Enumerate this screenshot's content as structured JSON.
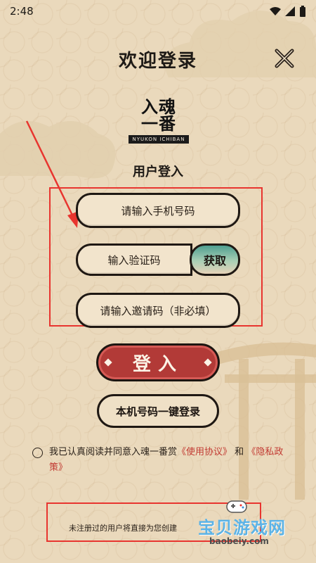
{
  "status": {
    "time": "2:48"
  },
  "header": {
    "title": "欢迎登录"
  },
  "logo": {
    "line1": "入魂",
    "line2": "一番",
    "band": "NYUKON ICHIBAN"
  },
  "subtitle": "用户登入",
  "form": {
    "phone_placeholder": "请输入手机号码",
    "code_placeholder": "输入验证码",
    "get_code_label": "获取",
    "invite_placeholder": "请输入邀请码（非必填）"
  },
  "buttons": {
    "login_label": "登入",
    "quick_login_label": "本机号码一键登录"
  },
  "agreement": {
    "prefix": "我已认真阅读并同意入魂一番赏",
    "terms_link": "《使用协议》",
    "and": "和",
    "privacy_link": "《隐私政策》"
  },
  "notice": "未注册过的用户将直接为您创建",
  "watermark": {
    "main": "宝贝游戏网",
    "sub": "baobeiy.com"
  },
  "colors": {
    "accent_red": "#b23a37",
    "annotation_red": "#e8352f",
    "background": "#ead9bc",
    "teal": "#4f9f90"
  },
  "icons": [
    "wifi-icon",
    "signal-icon",
    "battery-icon",
    "close-icon",
    "radio-unchecked-icon",
    "gamepad-icon"
  ]
}
